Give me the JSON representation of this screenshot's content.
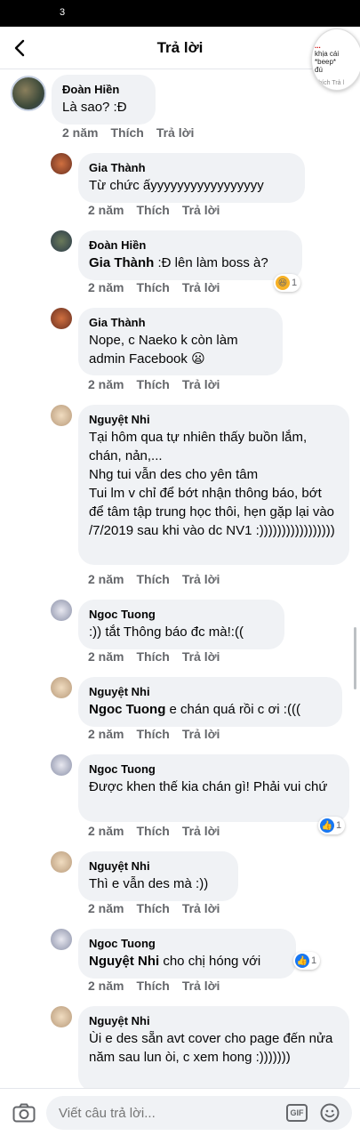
{
  "status_bar": {
    "left_text": "3"
  },
  "header": {
    "title": "Trả lời"
  },
  "floating_thumb": {
    "line1": "...",
    "line2": "khịa cái *beep*",
    "line3": "đú",
    "line4": "Thích  Trả l"
  },
  "actions": {
    "like": "Thích",
    "reply": "Trả lời"
  },
  "comments": [
    {
      "author": "Đoàn Hiền",
      "text": "Là sao? :Đ",
      "time": "2 năm"
    },
    {
      "author": "Gia Thành",
      "text": "Từ chức ấyyyyyyyyyyyyyyyyy",
      "time": "2 năm"
    },
    {
      "author": "Đoàn Hiền",
      "mention": "Gia Thành",
      "text": " :Đ lên làm boss à?",
      "time": "2 năm",
      "reaction_count": "1"
    },
    {
      "author": "Gia Thành",
      "text": "Nope, c Naeko k còn làm admin Facebook 😦",
      "time": "2 năm"
    },
    {
      "author": "Nguyệt Nhi",
      "text": "Tại hôm qua tự nhiên thấy buồn lắm, chán, nản,...\nNhg tui vẫn des cho yên tâm\nTui lm v chỉ để bớt nhận thông báo, bớt để tâm tập trung học thôi, hẹn gặp lại vào /7/2019 sau khi vào dc NV1 :)))))))))))))))))",
      "time": "2 năm"
    },
    {
      "author": "Ngoc Tuong",
      "text": ":)) tắt Thông báo đc mà!:((",
      "time": "2 năm"
    },
    {
      "author": "Nguyệt Nhi",
      "mention": "Ngoc Tuong",
      "text": " e chán quá rồi c ơi :(((",
      "time": "2 năm"
    },
    {
      "author": "Ngoc Tuong",
      "text": "Được khen thế kia chán gì! Phải vui chứ",
      "time": "2 năm",
      "reaction_count": "1"
    },
    {
      "author": "Nguyệt Nhi",
      "text": "Thì e vẫn des mà :))",
      "time": "2 năm"
    },
    {
      "author": "Ngoc Tuong",
      "mention": "Nguyệt Nhi",
      "text": " cho chị hóng với",
      "time": "2 năm",
      "reaction_count": "1"
    },
    {
      "author": "Nguyệt Nhi",
      "text": "Ùi e des sẵn avt cover cho page đến nửa năm sau lun òi, c xem hong :)))))))",
      "time": ""
    }
  ],
  "composer": {
    "placeholder": "Viết câu trả lời...",
    "gif_label": "GIF"
  },
  "colors": {
    "bubble": "#f0f2f5",
    "meta": "#65676b",
    "like_blue": "#1877f2",
    "haha_yellow": "#f7b125"
  }
}
